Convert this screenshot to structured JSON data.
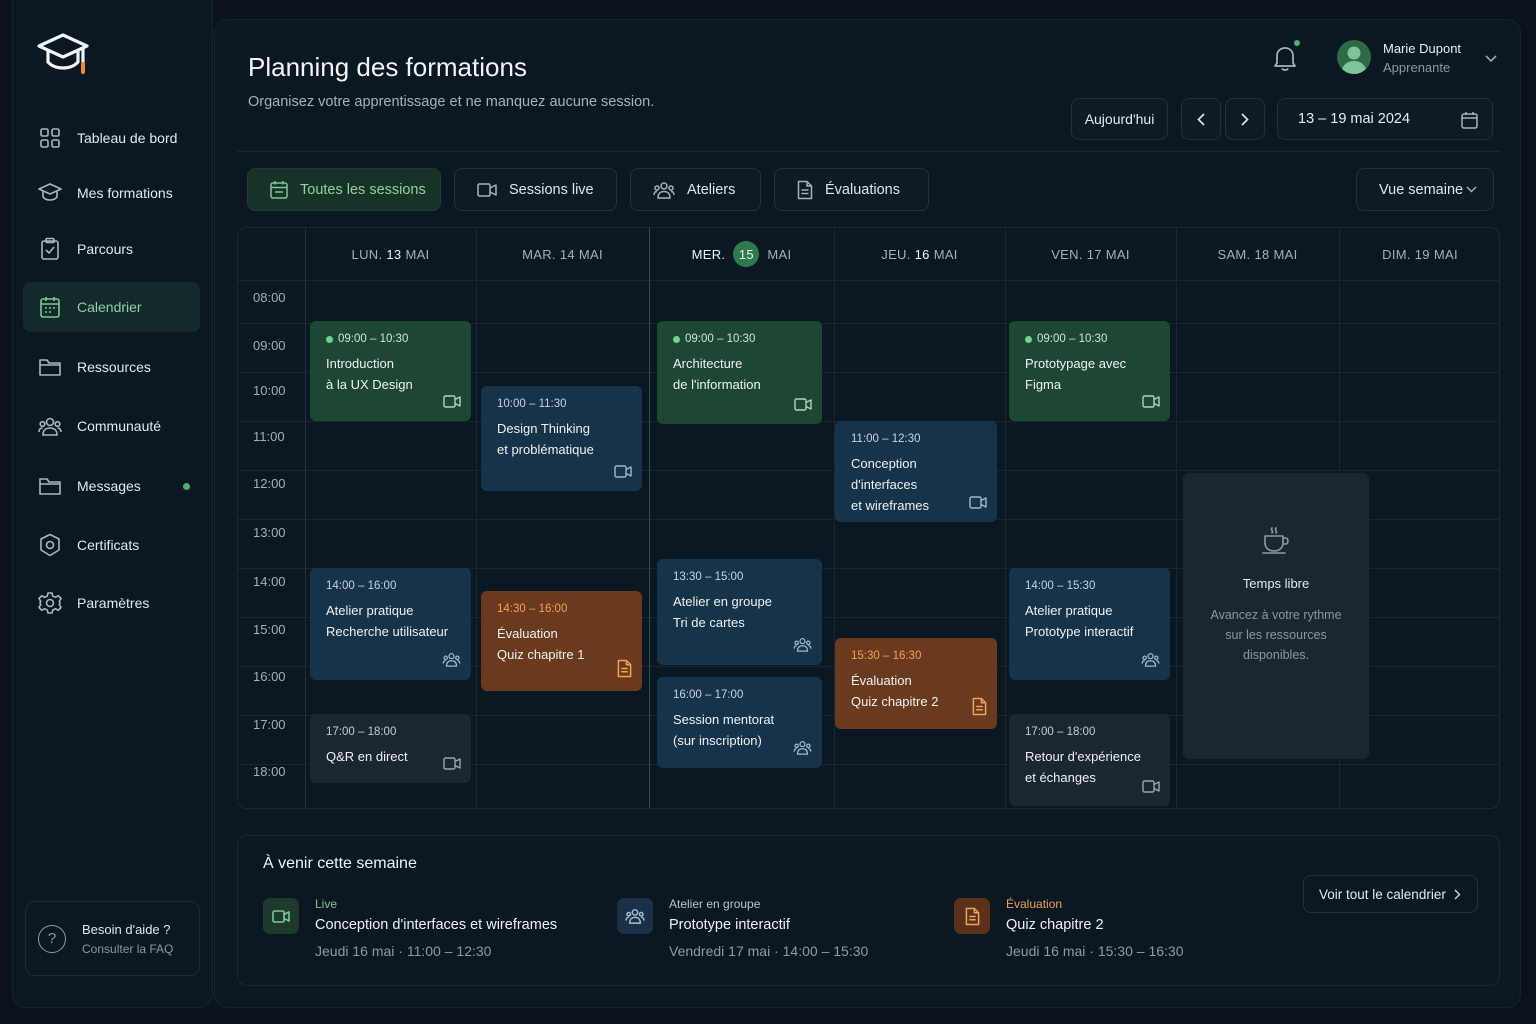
{
  "sidebar": {
    "items": [
      {
        "label": "Tableau de bord",
        "icon": "grid-icon"
      },
      {
        "label": "Mes formations",
        "icon": "graduation-cap-icon"
      },
      {
        "label": "Parcours",
        "icon": "clipboard-icon"
      },
      {
        "label": "Calendrier",
        "icon": "calendar-icon",
        "active": true
      },
      {
        "label": "Ressources",
        "icon": "folder-icon"
      },
      {
        "label": "Communauté",
        "icon": "users-icon"
      },
      {
        "label": "Messages",
        "icon": "folder-icon",
        "unread": true
      },
      {
        "label": "Certificats",
        "icon": "badge-icon"
      },
      {
        "label": "Paramètres",
        "icon": "gear-icon"
      }
    ],
    "help": {
      "title": "Besoin d'aide ?",
      "link": "Consulter la FAQ",
      "icon": "question-icon"
    }
  },
  "header": {
    "title": "Planning des formations",
    "subtitle": "Organisez votre apprentissage et ne manquez aucune session.",
    "user": {
      "name": "Marie Dupont",
      "role": "Apprenante"
    },
    "today_label": "Aujourd'hui",
    "date_range": "13 – 19 mai 2024"
  },
  "filters": {
    "tabs": [
      {
        "label": "Toutes les sessions",
        "icon": "calendar-check-icon",
        "active": true
      },
      {
        "label": "Sessions live",
        "icon": "video-icon"
      },
      {
        "label": "Ateliers",
        "icon": "users-icon"
      },
      {
        "label": "Évaluations",
        "icon": "document-icon"
      }
    ],
    "view_select": "Vue semaine"
  },
  "calendar": {
    "days": [
      {
        "name": "LUN.",
        "num": "13",
        "month": "MAI"
      },
      {
        "name": "MAR.",
        "num": "14",
        "month": "MAI"
      },
      {
        "name": "MER.",
        "num": "15",
        "month": "MAI",
        "today": true
      },
      {
        "name": "JEU.",
        "num": "16",
        "month": "MAI"
      },
      {
        "name": "VEN.",
        "num": "17",
        "month": "MAI"
      },
      {
        "name": "SAM.",
        "num": "18",
        "month": "MAI"
      },
      {
        "name": "DIM.",
        "num": "19",
        "month": "MAI"
      }
    ],
    "hours": [
      "08:00",
      "09:00",
      "10:00",
      "11:00",
      "12:00",
      "13:00",
      "14:00",
      "15:00",
      "16:00",
      "17:00",
      "18:00"
    ],
    "events": [
      {
        "time": "09:00 – 10:30",
        "line1": "Introduction",
        "line2": "à la UX Design",
        "kind": "live",
        "color": "green"
      },
      {
        "time": "10:00 – 11:30",
        "line1": "Design Thinking",
        "line2": "et problématique",
        "kind": "live",
        "color": "blue"
      },
      {
        "time": "09:00 – 10:30",
        "line1": "Architecture",
        "line2": "de l'information",
        "kind": "live",
        "color": "green"
      },
      {
        "time": "11:00 – 12:30",
        "line1": "Conception d'interfaces",
        "line2": "et wireframes",
        "kind": "live",
        "color": "blue"
      },
      {
        "time": "09:00 – 10:30",
        "line1": "Prototypage avec",
        "line2": "Figma",
        "kind": "live",
        "color": "green"
      },
      {
        "time": "14:00 – 16:00",
        "line1": "Atelier pratique",
        "line2": "Recherche utilisateur",
        "kind": "workshop",
        "color": "blue"
      },
      {
        "time": "14:30 – 16:00",
        "line1": "Évaluation",
        "line2": "Quiz chapitre 1",
        "kind": "evaluation",
        "color": "orange"
      },
      {
        "time": "13:30 – 15:00",
        "line1": "Atelier en groupe",
        "line2": "Tri de cartes",
        "kind": "workshop",
        "color": "blue"
      },
      {
        "time": "15:30 – 16:30",
        "line1": "Évaluation",
        "line2": "Quiz chapitre 2",
        "kind": "evaluation",
        "color": "orange"
      },
      {
        "time": "14:00 – 15:30",
        "line1": "Atelier pratique",
        "line2": "Prototype interactif",
        "kind": "workshop",
        "color": "blue"
      },
      {
        "time": "17:00 – 18:00",
        "line1": "Q&R en direct",
        "line2": "",
        "kind": "live",
        "color": "gray"
      },
      {
        "time": "16:00 – 17:00",
        "line1": "Session mentorat",
        "line2": "(sur inscription)",
        "kind": "workshop",
        "color": "blue"
      },
      {
        "time": "17:00 – 18:00",
        "line1": "Retour d'expérience",
        "line2": "et échanges",
        "kind": "live",
        "color": "gray"
      }
    ],
    "free_time": {
      "title": "Temps libre",
      "desc1": "Avancez à votre rythme",
      "desc2": "sur les ressources",
      "desc3": "disponibles.",
      "icon": "coffee-cup-icon"
    }
  },
  "upcoming": {
    "title": "À venir cette semaine",
    "see_all": "Voir tout le calendrier",
    "items": [
      {
        "type": "Live",
        "type_color": "#7cc894",
        "name": "Conception d'interfaces et wireframes",
        "day": "Jeudi 16 mai",
        "hours": "11:00 – 12:30",
        "icon": "video-icon"
      },
      {
        "type": "Atelier en groupe",
        "type_color": "#b9c4cc",
        "name": "Prototype interactif",
        "day": "Vendredi 17 mai",
        "hours": "14:00 – 15:30",
        "icon": "users-icon"
      },
      {
        "type": "Évaluation",
        "type_color": "#f0a15b",
        "name": "Quiz chapitre 2",
        "day": "Jeudi 16 mai",
        "hours": "15:30 – 16:30",
        "icon": "document-icon"
      }
    ]
  }
}
